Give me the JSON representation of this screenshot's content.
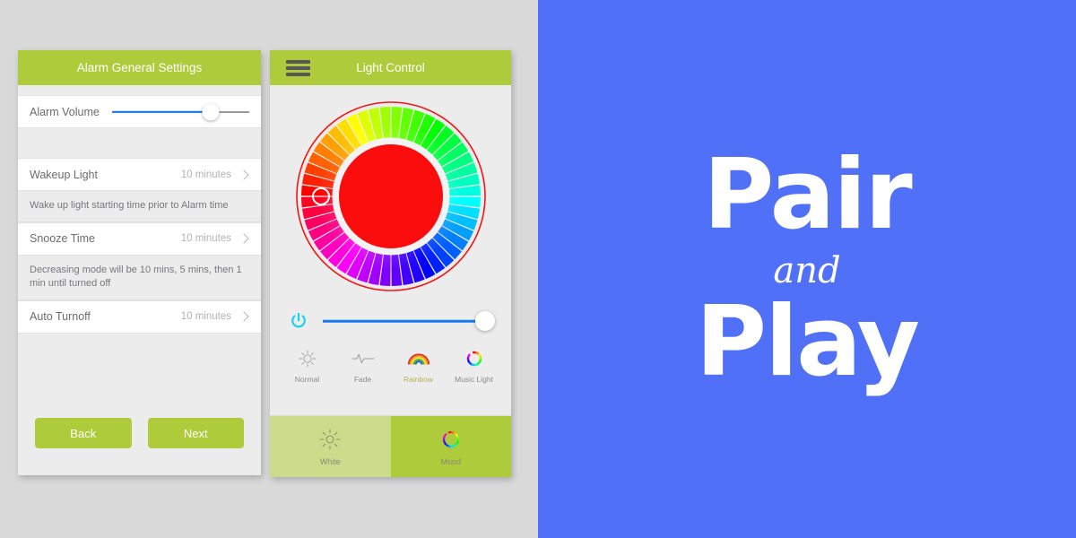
{
  "colors": {
    "brand_green": "#adcb3b",
    "brand_green_light": "#cbdc8b",
    "promo_blue": "#5070f7",
    "slider_blue": "#1879f3",
    "power_cyan": "#12d0f0",
    "page_bg": "#d9d9d9",
    "panel_bg": "#ececed",
    "selected_color": "#fb0d0d"
  },
  "alarm_panel": {
    "title": "Alarm General Settings",
    "volume_row": {
      "label": "Alarm Volume",
      "value_percent": 72
    },
    "rows": [
      {
        "label": "Wakeup Light",
        "value": "10 minutes",
        "note": "Wake up light starting time prior to Alarm time"
      },
      {
        "label": "Snooze Time",
        "value": "10 minutes",
        "note": "Decreasing mode will be 10 mins, 5 mins, then 1 min until turned off"
      },
      {
        "label": "Auto Turnoff",
        "value": "10 minutes",
        "note": ""
      }
    ],
    "buttons": {
      "back": "Back",
      "next": "Next"
    }
  },
  "light_panel": {
    "title": "Light Control",
    "menu_icon": "hamburger-icon",
    "color_wheel": {
      "selected_hex": "#fb0d0d",
      "handle_angle_deg": 180
    },
    "brightness": {
      "power_icon": "power-icon",
      "value_percent": 100
    },
    "modes": [
      {
        "label": "Normal",
        "icon": "sun-icon",
        "active": false
      },
      {
        "label": "Fade",
        "icon": "waveform-icon",
        "active": false
      },
      {
        "label": "Rainbow",
        "icon": "rainbow-icon",
        "active": true
      },
      {
        "label": "Music Light",
        "icon": "color-ring-icon",
        "active": false
      }
    ],
    "tabs": [
      {
        "label": "White",
        "icon": "sun-rays-icon",
        "selected": false
      },
      {
        "label": "Mood",
        "icon": "color-ring-icon",
        "selected": true
      }
    ]
  },
  "promo": {
    "line1": "Pair",
    "line2": "and",
    "line3": "Play"
  }
}
